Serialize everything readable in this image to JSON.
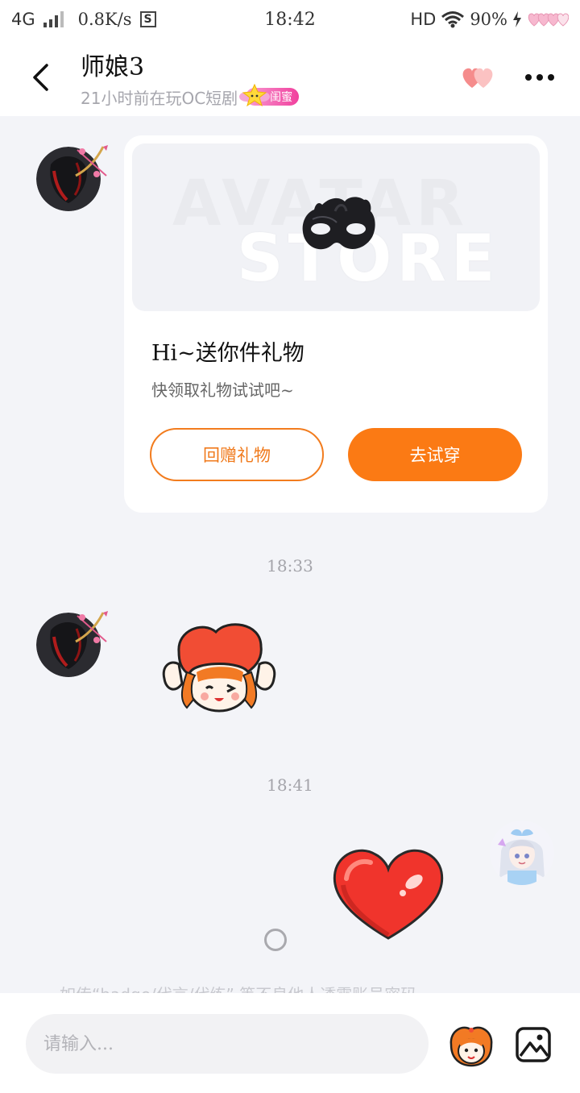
{
  "status_bar": {
    "network": "4G",
    "speed": "0.8K/s",
    "sim_icon": "S",
    "time": "18:42",
    "hd": "HD",
    "battery": "90%"
  },
  "header": {
    "title": "师娘3",
    "subtitle": "21小时前在玩OC短剧",
    "badge": "闺蜜"
  },
  "gift_card": {
    "watermark_line1": "AVATAR",
    "watermark_line2": "STORE",
    "title": "Hi~送你件礼物",
    "subtitle": "快领取礼物试试吧~",
    "return_gift_label": "回赠礼物",
    "try_on_label": "去试穿"
  },
  "timestamps": [
    "18:33",
    "18:41"
  ],
  "notice": "如传“badge/代言/代练” 等不良他人透露账号密码",
  "input": {
    "placeholder": "请输入..."
  },
  "colors": {
    "accent_orange": "#fb7a14",
    "badge_pink": "#f1409d",
    "background": "#f3f4f8"
  }
}
